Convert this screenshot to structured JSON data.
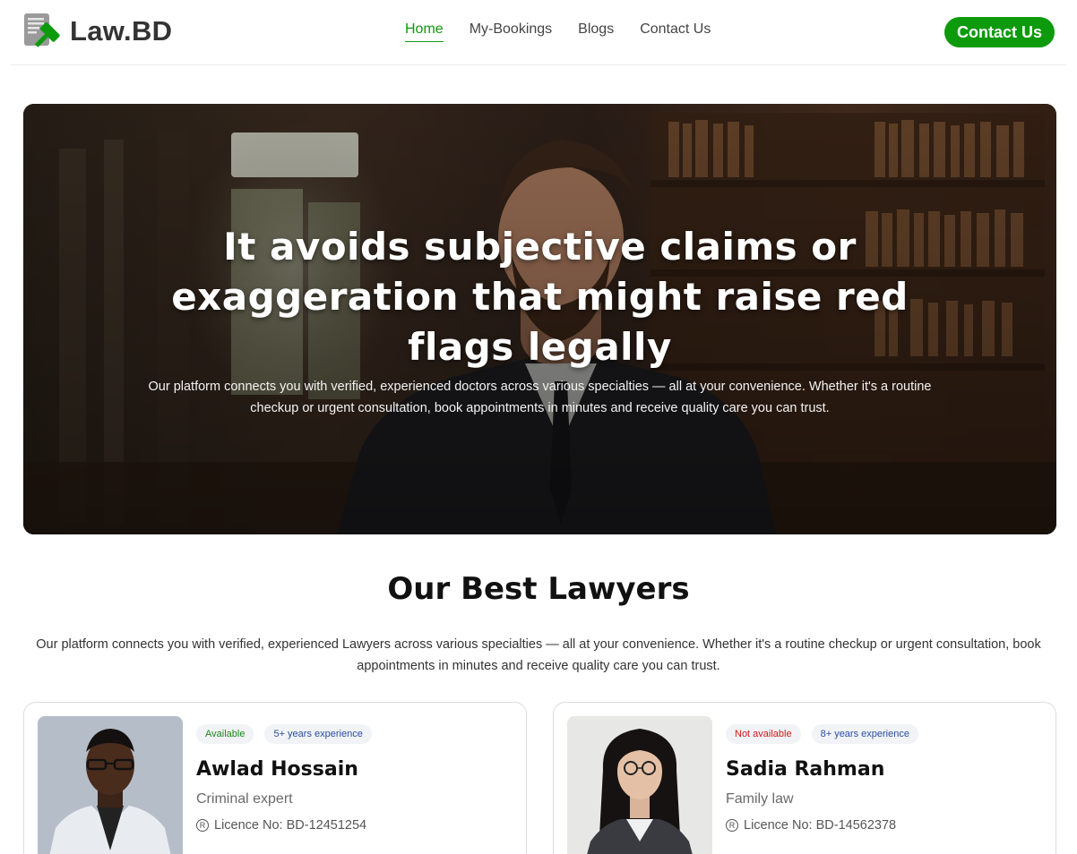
{
  "brand": {
    "name": "Law.BD",
    "accent": "#0d9a0d"
  },
  "nav": {
    "items": [
      {
        "label": "Home",
        "active": true
      },
      {
        "label": "My-Bookings",
        "active": false
      },
      {
        "label": "Blogs",
        "active": false
      },
      {
        "label": "Contact Us",
        "active": false
      }
    ],
    "cta_label": "Contact Us"
  },
  "hero": {
    "title": "It avoids subjective claims or exaggeration that might raise red flags legally",
    "subtitle": "Our platform connects you with verified, experienced doctors across various specialties — all at your convenience. Whether it's a routine checkup or urgent consultation, book appointments in minutes and receive quality care you can trust."
  },
  "lawyers_section": {
    "title": "Our Best Lawyers",
    "subtitle": "Our platform connects you with verified, experienced Lawyers across various specialties — all at your convenience. Whether it's a routine checkup or urgent consultation, book appointments in minutes and receive quality care you can trust.",
    "cards": [
      {
        "status": "Available",
        "experience": "5+ years experience",
        "name": "Awlad Hossain",
        "specialty": "Criminal expert",
        "licence": "Licence No: BD-12451254"
      },
      {
        "status": "Not available",
        "experience": "8+ years experience",
        "name": "Sadia Rahman",
        "specialty": "Family law",
        "licence": "Licence No: BD-14562378"
      }
    ]
  }
}
